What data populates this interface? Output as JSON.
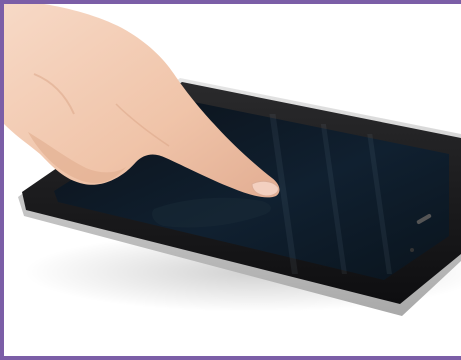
{
  "image": {
    "subject": "finger-touching-tablet",
    "frame_color": "#7b5ea7",
    "background_color": "#ffffff",
    "device_body_color": "#c9c9c9",
    "screen_color": "#0d1a24",
    "skin_color": "#f1c7ad"
  }
}
